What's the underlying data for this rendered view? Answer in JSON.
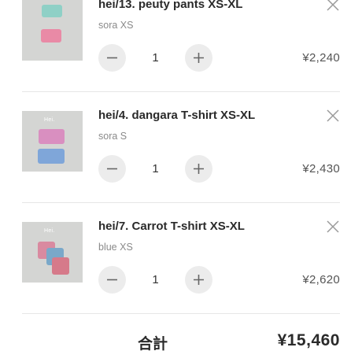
{
  "cart": {
    "items": [
      {
        "title": "hei/13. peuty pants XS-XL",
        "variant": "sora XS",
        "quantity": "1",
        "price": "¥2,240",
        "thumbnail_icon": "pants-photo",
        "brand_mark": ""
      },
      {
        "title": "hei/4. dangara T-shirt XS-XL",
        "variant": "sora S",
        "quantity": "1",
        "price": "¥2,430",
        "thumbnail_icon": "tshirt-photo",
        "brand_mark": "Hei."
      },
      {
        "title": "hei/7. Carrot T-shirt XS-XL",
        "variant": "blue XS",
        "quantity": "1",
        "price": "¥2,620",
        "thumbnail_icon": "tshirt-photo",
        "brand_mark": "Hei."
      }
    ]
  },
  "summary": {
    "total_label": "合計",
    "total_value": "¥15,460"
  },
  "colors": {
    "divider": "#e6e6e6",
    "qty_button_bg": "#ececec",
    "thumbnail_bg": "#d4d5d3"
  }
}
